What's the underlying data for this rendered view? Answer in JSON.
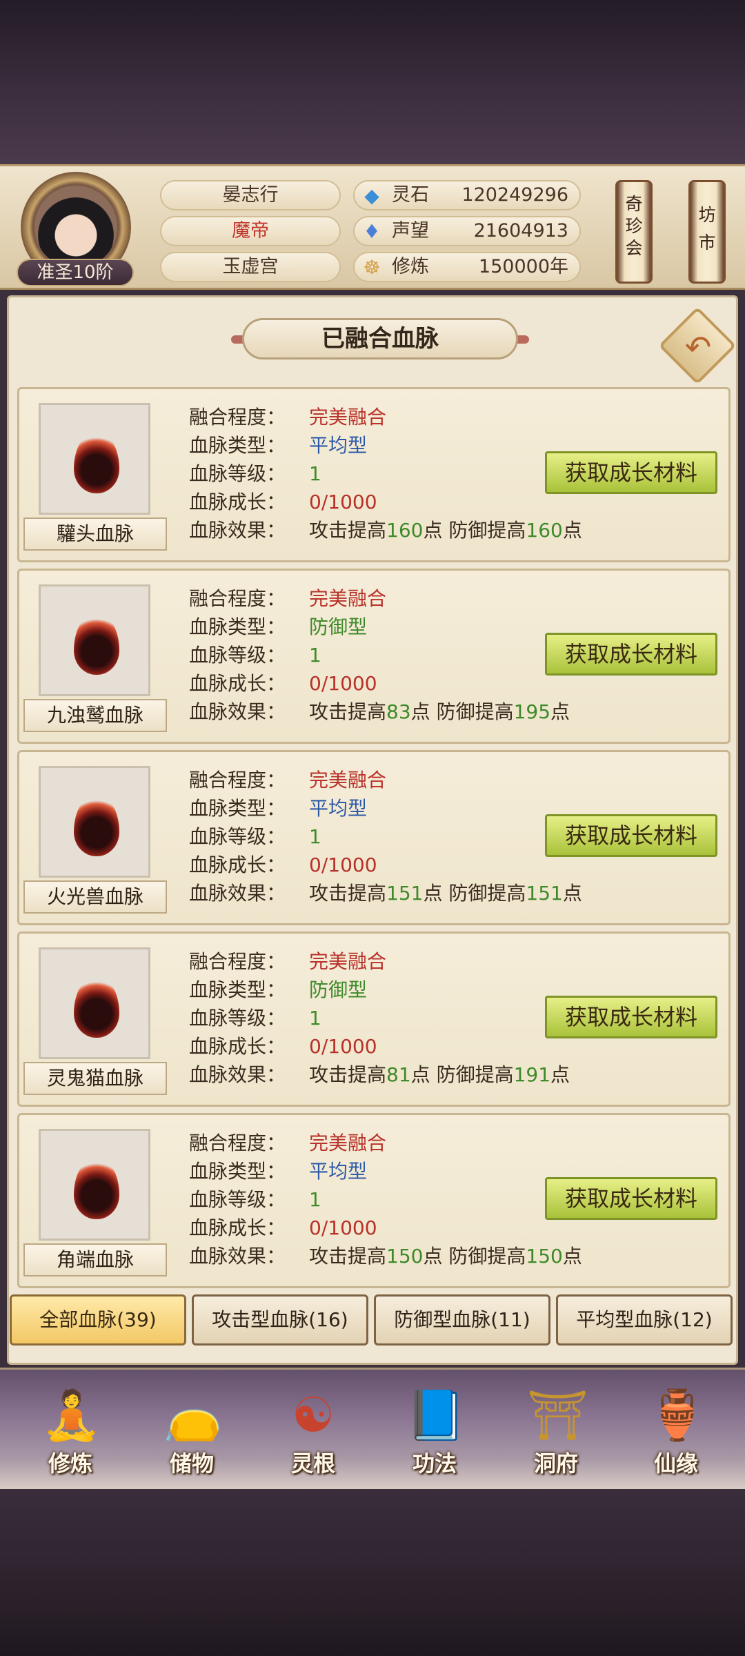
{
  "player": {
    "name": "晏志行",
    "title": "魔帝",
    "sect": "玉虚宫",
    "rank": "准圣10阶"
  },
  "resources": [
    {
      "icon": "spirit-stone-icon",
      "glyph": "◆",
      "color": "#3b8fd6",
      "label": "灵石",
      "value": "120249296"
    },
    {
      "icon": "prestige-icon",
      "glyph": "♦",
      "color": "#4c7fd8",
      "label": "声望",
      "value": "21604913"
    },
    {
      "icon": "cultivation-icon",
      "glyph": "☸",
      "color": "#d4a24a",
      "label": "修炼",
      "value": "150000年"
    }
  ],
  "scroll_buttons": [
    {
      "chars": [
        "奇",
        "珍",
        "会"
      ]
    },
    {
      "chars": [
        "坊",
        "市"
      ]
    }
  ],
  "panel_title": "已融合血脉",
  "labels": {
    "fusion": "融合程度：",
    "type": "血脉类型：",
    "level": "血脉等级：",
    "growth": "血脉成长：",
    "effect": "血脉效果：",
    "get_button": "获取成长材料",
    "atk_prefix": "攻击提高",
    "def_prefix": "防御提高",
    "point": "点"
  },
  "bloodlines": [
    {
      "name": "驩头血脉",
      "fusion": "完美融合",
      "type": "平均型",
      "type_color": "blue",
      "level": "1",
      "growth": "0/1000",
      "atk": "160",
      "def": "160"
    },
    {
      "name": "九浊鹫血脉",
      "fusion": "完美融合",
      "type": "防御型",
      "type_color": "green",
      "level": "1",
      "growth": "0/1000",
      "atk": "83",
      "def": "195"
    },
    {
      "name": "火光兽血脉",
      "fusion": "完美融合",
      "type": "平均型",
      "type_color": "blue",
      "level": "1",
      "growth": "0/1000",
      "atk": "151",
      "def": "151"
    },
    {
      "name": "灵鬼猫血脉",
      "fusion": "完美融合",
      "type": "防御型",
      "type_color": "green",
      "level": "1",
      "growth": "0/1000",
      "atk": "81",
      "def": "191"
    },
    {
      "name": "角端血脉",
      "fusion": "完美融合",
      "type": "平均型",
      "type_color": "blue",
      "level": "1",
      "growth": "0/1000",
      "atk": "150",
      "def": "150"
    }
  ],
  "filter_tabs": [
    {
      "label": "全部血脉(39)",
      "active": true
    },
    {
      "label": "攻击型血脉(16)",
      "active": false
    },
    {
      "label": "防御型血脉(11)",
      "active": false
    },
    {
      "label": "平均型血脉(12)",
      "active": false
    }
  ],
  "nav": [
    {
      "label": "修炼",
      "icon": "meditate-icon",
      "glyph": "🧘"
    },
    {
      "label": "储物",
      "icon": "storage-bag-icon",
      "glyph": "👝"
    },
    {
      "label": "灵根",
      "icon": "spirit-root-icon",
      "glyph": "☯"
    },
    {
      "label": "功法",
      "icon": "technique-book-icon",
      "glyph": "📘"
    },
    {
      "label": "洞府",
      "icon": "cave-dwelling-icon",
      "glyph": "⛩"
    },
    {
      "label": "仙缘",
      "icon": "immortal-fate-icon",
      "glyph": "🏺"
    }
  ]
}
